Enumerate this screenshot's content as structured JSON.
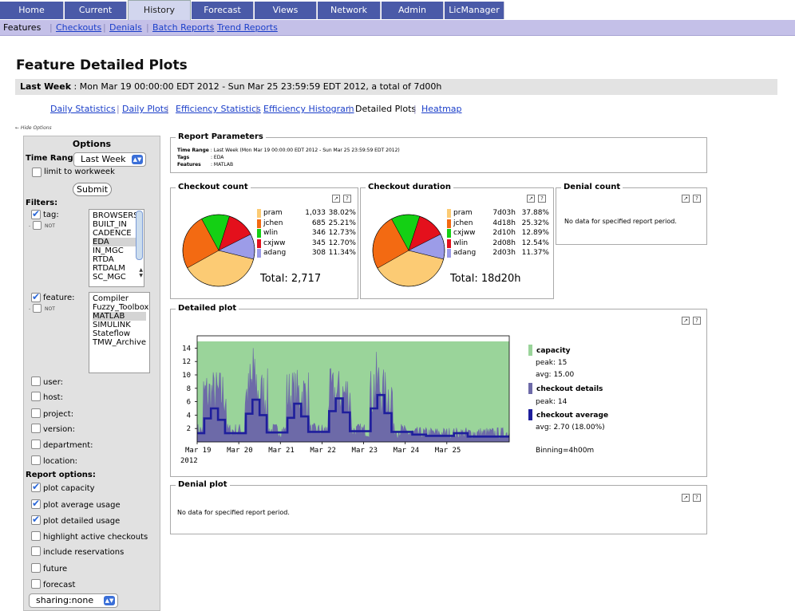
{
  "topnav": {
    "tabs": [
      {
        "label": "Home",
        "active": false
      },
      {
        "label": "Current",
        "active": false
      },
      {
        "label": "History",
        "active": true
      },
      {
        "label": "Forecast",
        "active": false
      },
      {
        "label": "Views",
        "active": false
      },
      {
        "label": "Network",
        "active": false
      },
      {
        "label": "Admin",
        "active": false
      },
      {
        "label": "LicManager",
        "active": false
      }
    ]
  },
  "subnav": {
    "first": "Features",
    "links": [
      "Checkouts",
      "Denials",
      "Batch Reports",
      "Trend Reports"
    ]
  },
  "page": {
    "title": "Feature Detailed Plots",
    "range_label": "Last Week",
    "range_text": " : Mon Mar 19 00:00:00 EDT 2012 - Sun Mar 25 23:59:59 EDT 2012, a total of 7d00h",
    "hide_options": "← Hide Options"
  },
  "report_links": [
    "Daily Statistics",
    "Daily Plots",
    "Efficiency Statistics",
    "Efficiency Histogram",
    "Detailed Plots",
    "Heatmap"
  ],
  "options": {
    "header": "Options",
    "time_range_label": "Time Range:",
    "time_range_value": "Last Week",
    "limit_workweek": "limit to workweek",
    "submit": "Submit",
    "filters_label": "Filters:",
    "tag_label": "tag:",
    "not_label": "NOT",
    "tags": [
      "BROWSERS",
      "BUILT_IN",
      "CADENCE",
      "EDA",
      "IN_MGC",
      "RTDA",
      "RTDALM",
      "SC_MGC"
    ],
    "tag_selected": "EDA",
    "feature_label": "feature:",
    "features": [
      "Compiler",
      "Fuzzy_Toolbox",
      "MATLAB",
      "SIMULINK",
      "Stateflow",
      "TMW_Archive"
    ],
    "feature_selected": "MATLAB",
    "other_filters": [
      "user:",
      "host:",
      "project:",
      "version:",
      "department:",
      "location:"
    ],
    "report_options_label": "Report options:",
    "report_options": [
      {
        "label": "plot capacity",
        "checked": true
      },
      {
        "label": "plot average usage",
        "checked": true
      },
      {
        "label": "plot detailed usage",
        "checked": true
      },
      {
        "label": "highlight active checkouts",
        "checked": false
      },
      {
        "label": "include reservations",
        "checked": false
      },
      {
        "label": "future",
        "checked": false
      },
      {
        "label": "forecast",
        "checked": false
      }
    ],
    "sharing_value": "sharing:none"
  },
  "params": {
    "title": "Report Parameters",
    "time_range_key": "Time Range",
    "time_range_val": ": Last Week (Mon Mar 19 00:00:00 EDT 2012 - Sun Mar 25 23:59:59 EDT 2012)",
    "tags_key": "Tags",
    "tags_val": ": EDA",
    "features_key": "Features",
    "features_val": ": MATLAB"
  },
  "checkout_count": {
    "title": "Checkout count",
    "total": "Total: 2,717",
    "rows": [
      {
        "name": "pram",
        "value": "1,033",
        "pct": "38.02%",
        "color": "#fccb74"
      },
      {
        "name": "jchen",
        "value": "685",
        "pct": "25.21%",
        "color": "#f36a12"
      },
      {
        "name": "wlin",
        "value": "346",
        "pct": "12.73%",
        "color": "#14d014"
      },
      {
        "name": "cxjww",
        "value": "345",
        "pct": "12.70%",
        "color": "#e4101c"
      },
      {
        "name": "adang",
        "value": "308",
        "pct": "11.34%",
        "color": "#9c9ce8"
      }
    ]
  },
  "checkout_duration": {
    "title": "Checkout duration",
    "total": "Total: 18d20h",
    "rows": [
      {
        "name": "pram",
        "value": "7d03h",
        "pct": "37.88%",
        "color": "#fccb74"
      },
      {
        "name": "jchen",
        "value": "4d18h",
        "pct": "25.32%",
        "color": "#f36a12"
      },
      {
        "name": "cxjww",
        "value": "2d10h",
        "pct": "12.89%",
        "color": "#14d014"
      },
      {
        "name": "wlin",
        "value": "2d08h",
        "pct": "12.54%",
        "color": "#e4101c"
      },
      {
        "name": "adang",
        "value": "2d03h",
        "pct": "11.37%",
        "color": "#9c9ce8"
      }
    ]
  },
  "denial_count": {
    "title": "Denial count",
    "message": "No data for specified report period."
  },
  "detailed_plot": {
    "title": "Detailed plot",
    "legend": {
      "capacity": "capacity",
      "capacity_peak": "peak: 15",
      "capacity_avg": "avg: 15.00",
      "details": "checkout details",
      "details_peak": "peak: 14",
      "average": "checkout average",
      "average_avg": "avg: 2.70 (18.00%)",
      "binning": "Binning=4h00m"
    },
    "year_label": "2012"
  },
  "denial_plot": {
    "title": "Denial plot",
    "message": "No data for specified report period."
  },
  "chart_data": [
    {
      "type": "pie",
      "title": "Checkout count",
      "categories": [
        "pram",
        "jchen",
        "wlin",
        "cxjww",
        "adang"
      ],
      "values": [
        1033,
        685,
        346,
        345,
        308
      ],
      "colors": [
        "#fccb74",
        "#f36a12",
        "#14d014",
        "#e4101c",
        "#9c9ce8"
      ]
    },
    {
      "type": "pie",
      "title": "Checkout duration",
      "categories": [
        "pram",
        "jchen",
        "cxjww",
        "wlin",
        "adang"
      ],
      "values": [
        37.88,
        25.32,
        12.89,
        12.54,
        11.37
      ],
      "colors": [
        "#fccb74",
        "#f36a12",
        "#14d014",
        "#e4101c",
        "#9c9ce8"
      ]
    },
    {
      "type": "line",
      "title": "Detailed plot",
      "x_ticks": [
        "Mar 19",
        "Mar 20",
        "Mar 21",
        "Mar 22",
        "Mar 23",
        "Mar 24",
        "Mar 25"
      ],
      "y_ticks": [
        2,
        4,
        6,
        8,
        10,
        12,
        14
      ],
      "ylim": [
        0,
        15
      ],
      "xlim": [
        0,
        7.5
      ],
      "series": [
        {
          "name": "capacity",
          "color": "#9ad49a",
          "values": [
            [
              0,
              15
            ],
            [
              7.5,
              15
            ]
          ]
        },
        {
          "name": "checkout details",
          "color": "#6d6aa8",
          "peak": 14
        },
        {
          "name": "checkout average",
          "color": "#1e1e9c",
          "values": [
            [
              0,
              1.3
            ],
            [
              0.17,
              1.3
            ],
            [
              0.17,
              3.5
            ],
            [
              0.33,
              3.5
            ],
            [
              0.33,
              5
            ],
            [
              0.5,
              5
            ],
            [
              0.5,
              3.3
            ],
            [
              0.67,
              3.3
            ],
            [
              0.67,
              1.3
            ],
            [
              1.17,
              1.3
            ],
            [
              1.17,
              4.2
            ],
            [
              1.33,
              4.2
            ],
            [
              1.33,
              6.3
            ],
            [
              1.5,
              6.3
            ],
            [
              1.5,
              4
            ],
            [
              1.67,
              4
            ],
            [
              1.67,
              1.4
            ],
            [
              2.17,
              1.4
            ],
            [
              2.17,
              3.6
            ],
            [
              2.33,
              3.6
            ],
            [
              2.33,
              5.7
            ],
            [
              2.5,
              5.7
            ],
            [
              2.5,
              3.8
            ],
            [
              2.67,
              3.8
            ],
            [
              2.67,
              1.5
            ],
            [
              3.17,
              1.5
            ],
            [
              3.17,
              4.6
            ],
            [
              3.33,
              4.6
            ],
            [
              3.33,
              6.5
            ],
            [
              3.5,
              6.5
            ],
            [
              3.5,
              4.4
            ],
            [
              3.67,
              4.4
            ],
            [
              3.67,
              1.6
            ],
            [
              4.17,
              1.6
            ],
            [
              4.17,
              5
            ],
            [
              4.33,
              5
            ],
            [
              4.33,
              7
            ],
            [
              4.5,
              7
            ],
            [
              4.5,
              4.3
            ],
            [
              4.67,
              4.3
            ],
            [
              4.67,
              1.5
            ],
            [
              5.17,
              1.5
            ],
            [
              5.17,
              1.1
            ],
            [
              5.5,
              1.1
            ],
            [
              5.5,
              0.9
            ],
            [
              6.17,
              0.9
            ],
            [
              6.17,
              1.3
            ],
            [
              6.5,
              1.3
            ],
            [
              6.5,
              0.8
            ],
            [
              7.5,
              0.8
            ]
          ]
        }
      ]
    }
  ]
}
